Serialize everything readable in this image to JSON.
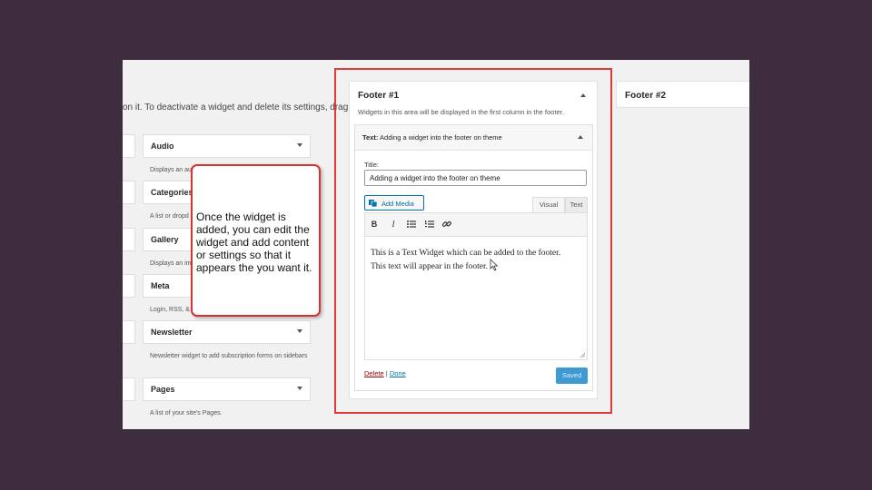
{
  "instructions": "on it. To deactivate a widget and delete its settings, drag",
  "available_widgets": [
    {
      "title": "Audio",
      "desc": "Displays an au"
    },
    {
      "title": "Categories",
      "desc": "A list or dropd"
    },
    {
      "title": "Gallery",
      "desc": "Displays an im"
    },
    {
      "title": "Meta",
      "desc": "Login, RSS, &"
    },
    {
      "title": "Newsletter",
      "desc": "Newsletter widget to add subscription forms on sidebars"
    },
    {
      "title": "Pages",
      "desc": "A list of your site's Pages."
    }
  ],
  "callout": {
    "text": "Once the widget is added, you can edit the widget and add content or settings so that it appears the you want it."
  },
  "footer1": {
    "title": "Footer #1",
    "description": "Widgets in this area will be displayed in the first column in the footer.",
    "widget": {
      "type_label": "Text:",
      "title_label": "Adding a widget into the footer on theme",
      "field_label": "Title:",
      "title_value": "Adding a widget into the footer on theme",
      "add_media_label": "Add Media",
      "tab_visual": "Visual",
      "tab_text": "Text",
      "toolbar": {
        "bold": "B",
        "italic": "I"
      },
      "content": "This is a Text Widget which can be added to the footer.  This text will appear in the footer.",
      "delete_label": "Delete",
      "separator": "|",
      "done_label": "Done",
      "saved_label": "Saved"
    }
  },
  "footer2": {
    "title": "Footer #2"
  },
  "colors": {
    "background": "#3e2d3e",
    "highlight": "#e23a3a",
    "link": "#0073aa",
    "delete": "#aa0000",
    "primary_button": "#3e9ad1"
  }
}
